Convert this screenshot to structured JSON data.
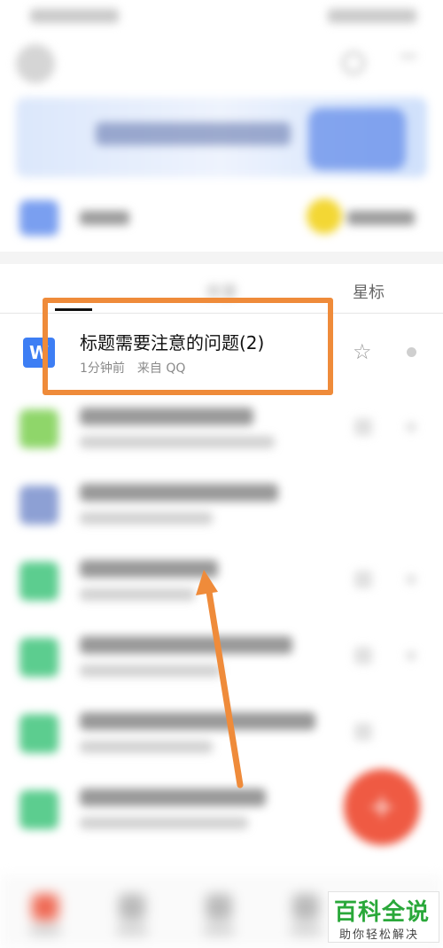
{
  "tabs": {
    "recent": "",
    "shared": "共享",
    "starred": "星标"
  },
  "highlighted_file": {
    "icon_letter": "W",
    "title": "标题需要注意的问题(2)",
    "time": "1分钟前",
    "source": "来自 QQ"
  },
  "icons": {
    "star": "☆",
    "fab": "+"
  },
  "colors": {
    "annotation": "#ef8b3a",
    "doc_icon": "#3d7ef4",
    "fab": "#ef5a43",
    "watermark": "#2aa83a"
  },
  "watermark": {
    "main": "百科全说",
    "sub": "助你轻松解决"
  }
}
